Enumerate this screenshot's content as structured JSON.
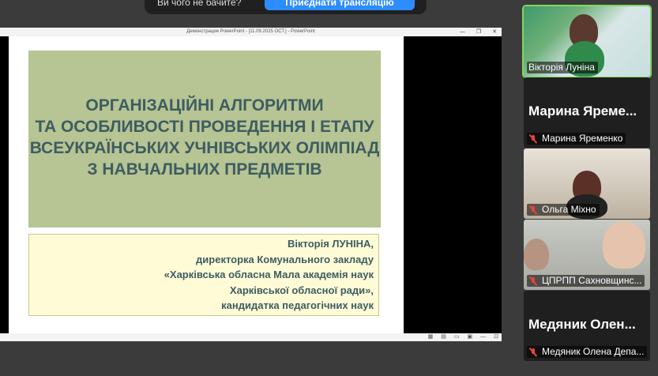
{
  "share_banner": {
    "message": "Ви чого не бачите?",
    "button_label": "Приєднати трансляцію"
  },
  "ppt_window": {
    "title": "Демонстрация PowerPoint - [11.09.2025 ОСТ.] - PowerPoint",
    "controls": [
      "—",
      "❐",
      "✕"
    ]
  },
  "slide": {
    "title_lines": [
      "ОРГАНІЗАЦІЙНІ АЛГОРИТМИ",
      "ТА ОСОБЛИВОСТІ ПРОВЕДЕННЯ І ЕТАПУ",
      "ВСЕУКРАЇНСЬКИХ УЧНІВСЬКИХ ОЛІМПІАД",
      "З НАВЧАЛЬНИХ ПРЕДМЕТІВ"
    ],
    "author_lines": [
      "Вікторія ЛУНІНА,",
      "директорка Комунального закладу",
      "«Харківська обласна Мала академія наук",
      "Харківської обласної ради»,",
      "кандидатка педагогічних наук"
    ]
  },
  "participants": [
    {
      "label": "Вікторія Луніна",
      "big_name": "",
      "muted": false,
      "video": true
    },
    {
      "label": "Марина Яременко",
      "big_name": "Марина  Яреме...",
      "muted": true,
      "video": false
    },
    {
      "label": "Ольга Міхно",
      "big_name": "",
      "muted": true,
      "video": true
    },
    {
      "label": "ЦПРПП Сахновщинс...",
      "big_name": "",
      "muted": true,
      "video": true
    },
    {
      "label": "Медяник Олена Депа...",
      "big_name": "Медяник  Олен...",
      "muted": true,
      "video": false
    }
  ],
  "colors": {
    "title_box": "#b7c493",
    "title_text": "#3d5d61",
    "author_box": "#fffbd6",
    "active_speaker": "#7fd85f",
    "muted": "#e8443a",
    "share_button": "#2d8cff"
  }
}
